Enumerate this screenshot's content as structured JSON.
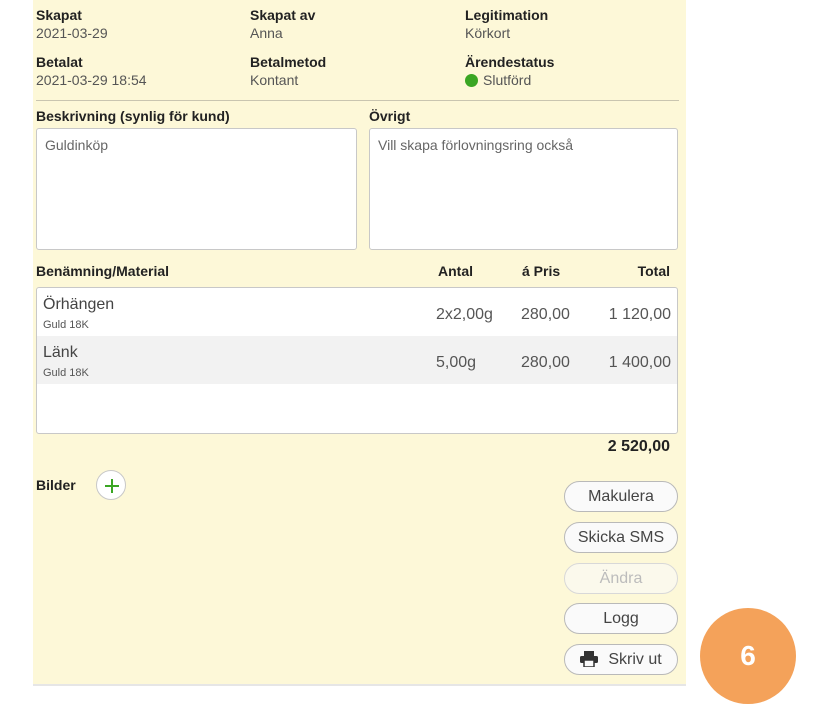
{
  "info": {
    "created_label": "Skapat",
    "created_value": "2021-03-29",
    "created_by_label": "Skapat av",
    "created_by_value": "Anna",
    "id_label": "Legitimation",
    "id_value": "Körkort",
    "paid_label": "Betalat",
    "paid_value": "2021-03-29 18:54",
    "payment_label": "Betalmetod",
    "payment_value": "Kontant",
    "status_label": "Ärendestatus",
    "status_value": "Slutförd",
    "status_color": "#3aa623"
  },
  "description": {
    "label": "Beskrivning (synlig för kund)",
    "value": "Guldinköp"
  },
  "other": {
    "label": "Övrigt",
    "value": "Vill skapa förlovningsring också"
  },
  "table": {
    "headers": {
      "name": "Benämning/Material",
      "qty": "Antal",
      "price": "á Pris",
      "total": "Total"
    },
    "rows": [
      {
        "name": "Örhängen",
        "material": "Guld 18K",
        "qty": "2x2,00g",
        "price": "280,00",
        "total": "1 120,00"
      },
      {
        "name": "Länk",
        "material": "Guld 18K",
        "qty": "5,00g",
        "price": "280,00",
        "total": "1 400,00"
      }
    ],
    "sum": "2 520,00"
  },
  "images": {
    "label": "Bilder",
    "add_icon": "plus-icon"
  },
  "actions": {
    "void": "Makulera",
    "send_sms": "Skicka SMS",
    "edit": "Ändra",
    "log": "Logg",
    "print": "Skriv ut",
    "print_icon": "printer-icon"
  },
  "step_badge": "6",
  "colors": {
    "panel_bg": "#fdf8d8",
    "badge": "#f4a25a",
    "accent_green": "#3aa623"
  }
}
